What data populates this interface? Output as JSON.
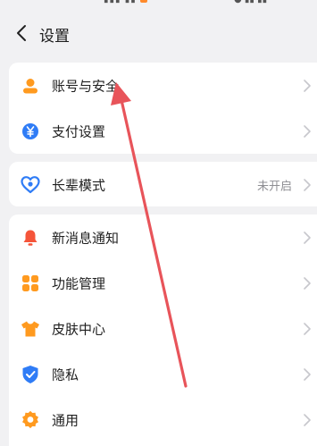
{
  "header": {
    "title": "设置"
  },
  "groups": [
    {
      "items": [
        {
          "label": "账号与安全",
          "icon": "person-icon"
        },
        {
          "label": "支付设置",
          "icon": "yuan-icon"
        }
      ]
    },
    {
      "items": [
        {
          "label": "长辈模式",
          "value": "未开启",
          "icon": "heart-icon"
        }
      ]
    },
    {
      "items": [
        {
          "label": "新消息通知",
          "icon": "bell-icon"
        },
        {
          "label": "功能管理",
          "icon": "grid-icon"
        },
        {
          "label": "皮肤中心",
          "icon": "shirt-icon"
        },
        {
          "label": "隐私",
          "icon": "shield-icon"
        },
        {
          "label": "通用",
          "icon": "gear-icon"
        }
      ]
    }
  ],
  "colors": {
    "orange": "#ff9a1f",
    "blue": "#2f7cf6",
    "red_orange": "#f5553a",
    "annotation_arrow": "#e8545a"
  }
}
